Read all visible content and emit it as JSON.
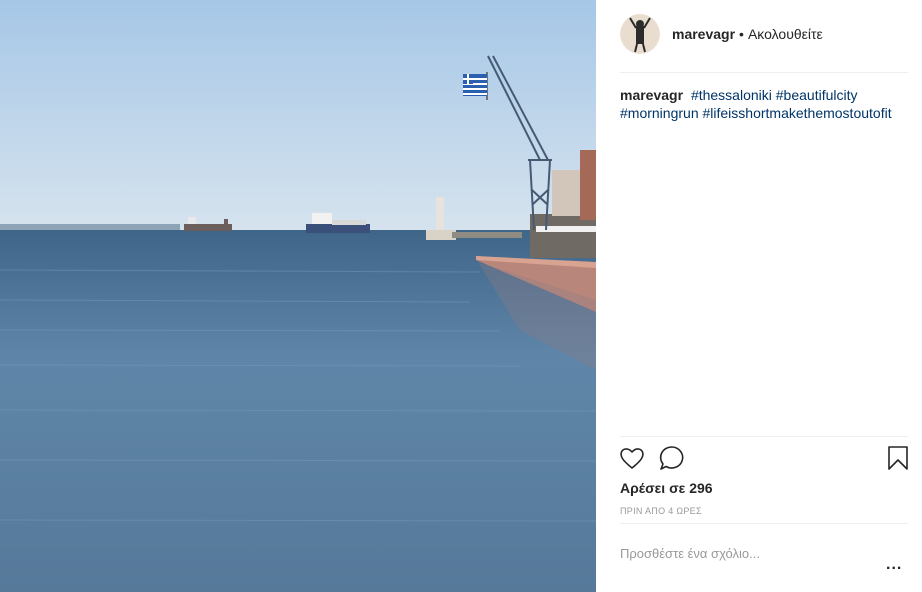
{
  "post": {
    "username": "marevagr",
    "separator": "•",
    "follow_status": "Ακολουθείτε",
    "caption_user": "marevagr",
    "hashtags": [
      "#thessaloniki",
      "#beautifulcity",
      "#morningrun",
      "#lifeisshortmakethemostoutofit"
    ],
    "likes_text": "Αρέσει σε 296",
    "time_text": "ΠΡΙΝ ΑΠΟ 4 ΩΡΕΣ",
    "comment_placeholder": "Προσθέστε ένα σχόλιο...",
    "more_label": "..."
  },
  "icons": [
    "heart-icon",
    "comment-icon",
    "bookmark-icon"
  ],
  "colors": {
    "hashtag": "#003569",
    "divider": "#efefef",
    "muted": "#999999",
    "sky_top": "#a9c9e8",
    "water": "#4f7396"
  }
}
